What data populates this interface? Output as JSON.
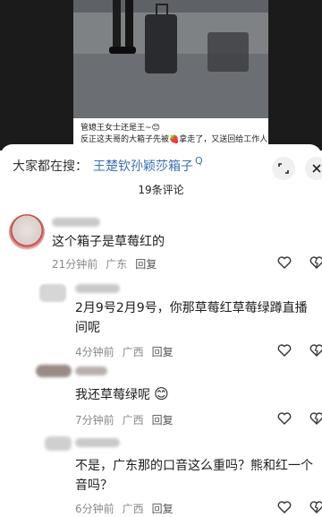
{
  "video": {
    "caption_line1": "管媳王女士还是王~😊",
    "caption_line2": "反正这夫哥的大箱子先被🍓拿走了，又送回给工作人"
  },
  "sheet": {
    "search_prefix": "大家都在搜：",
    "search_link": "王楚钦孙颖莎箱子",
    "search_q": "Q",
    "comment_count": "19条评论"
  },
  "comments": [
    {
      "text": "这个箱子是草莓红的",
      "time": "21分钟前",
      "region": "广东",
      "reply": "回复"
    },
    {
      "text": "2月9号2月9号，你那草莓红草莓绿蹲直播间呢",
      "time": "4分钟前",
      "region": "广西",
      "reply": "回复"
    },
    {
      "text": "我还草莓绿呢",
      "emoji": "😊",
      "time": "7分钟前",
      "region": "广西",
      "reply": "回复"
    },
    {
      "text": "不是，广东那的口音这么重吗？熊和红一个音吗？",
      "time": "6分钟前",
      "region": "广西",
      "reply": "回复"
    }
  ],
  "icons": {
    "expand": "fullscreen-icon",
    "close": "close-icon",
    "like": "heart-icon",
    "dislike": "broken-heart-icon"
  },
  "colors": {
    "link": "#3a6fb5",
    "meta": "#8a8a8a",
    "background": "#ffffff"
  }
}
